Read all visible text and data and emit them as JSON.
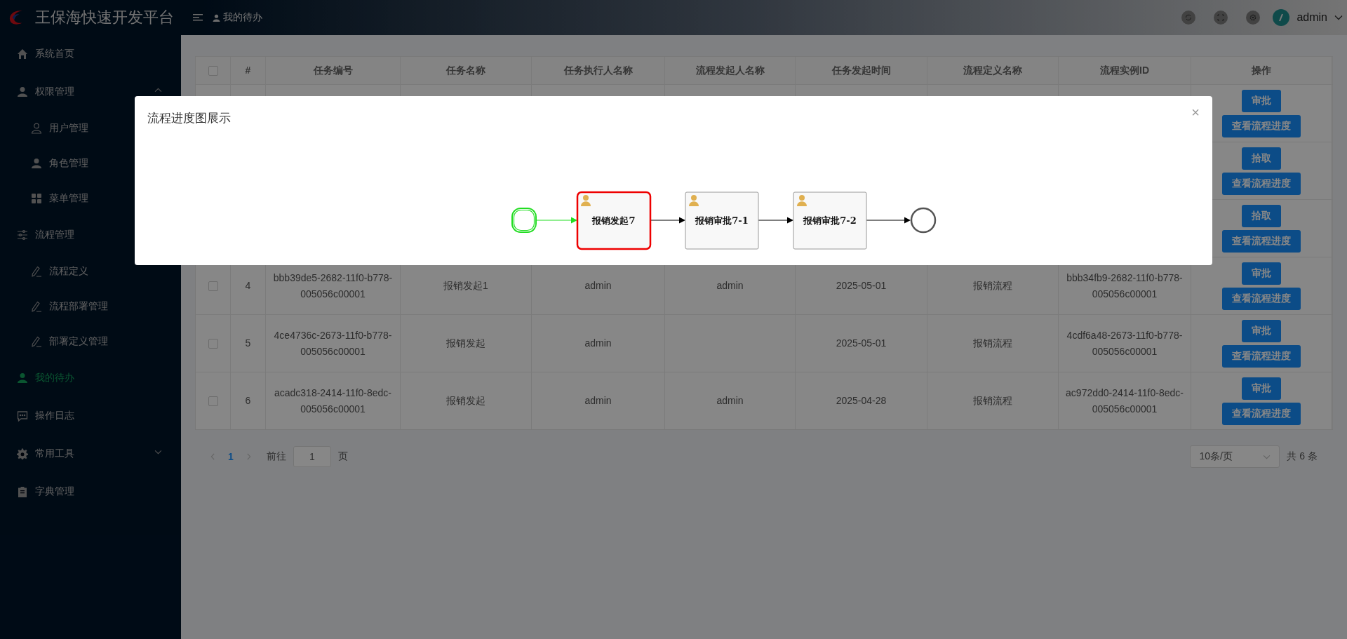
{
  "header": {
    "title": "王保海快速开发平台",
    "breadcrumb": "我的待办",
    "user": "admin"
  },
  "sidebar": {
    "items": [
      {
        "label": "系统首页",
        "selected": false
      },
      {
        "label": "权限管理",
        "selected": false,
        "expanded": true,
        "children": [
          {
            "label": "用户管理",
            "selected": false
          },
          {
            "label": "角色管理",
            "selected": false
          },
          {
            "label": "菜单管理",
            "selected": false
          }
        ]
      },
      {
        "label": "流程管理",
        "selected": false,
        "children": [
          {
            "label": "流程定义",
            "selected": false
          },
          {
            "label": "流程部署管理",
            "selected": false
          },
          {
            "label": "部署定义管理",
            "selected": false
          }
        ]
      },
      {
        "label": "我的待办",
        "selected": true
      },
      {
        "label": "操作日志",
        "selected": false
      },
      {
        "label": "常用工具",
        "selected": false,
        "expanded": false
      },
      {
        "label": "字典管理",
        "selected": false
      }
    ]
  },
  "table": {
    "columns": [
      "#",
      "任务编号",
      "任务名称",
      "任务执行人名称",
      "流程发起人名称",
      "任务发起时间",
      "流程定义名称",
      "流程实例ID",
      "操作"
    ],
    "header_checked": false,
    "rows": [
      {
        "actions": [
          "审批",
          "查看流程进度"
        ]
      },
      {
        "actions": [
          "拾取",
          "查看流程进度"
        ]
      },
      {
        "actions": [
          "拾取",
          "查看流程进度"
        ]
      },
      {
        "checked": false,
        "cells": [
          "4",
          "bbb39de5-2682-11f0-b778-005056c00001",
          "报销发起1",
          "admin",
          "admin",
          "2025-05-01",
          "报销流程",
          "bbb34fb9-2682-11f0-b778-005056c00001"
        ],
        "actions": [
          "审批",
          "查看流程进度"
        ]
      },
      {
        "checked": false,
        "cells": [
          "5",
          "4ce4736c-2673-11f0-b778-005056c00001",
          "报销发起",
          "admin",
          "",
          "2025-05-01",
          "报销流程",
          "4cdf6a48-2673-11f0-b778-005056c00001"
        ],
        "actions": [
          "审批",
          "查看流程进度"
        ]
      },
      {
        "checked": false,
        "cells": [
          "6",
          "acadc318-2414-11f0-8edc-005056c00001",
          "报销发起",
          "admin",
          "admin",
          "2025-04-28",
          "报销流程",
          "ac972dd0-2414-11f0-8edc-005056c00001"
        ],
        "actions": [
          "审批",
          "查看流程进度"
        ]
      }
    ]
  },
  "pagination": {
    "pages": [
      {
        "label": "1",
        "selected": true
      }
    ],
    "goto_label": "前往",
    "goto_value": "1",
    "goto_suffix": "页",
    "page_size": "10条/页",
    "total": "共 6 条"
  },
  "dialog": {
    "title": "流程进度图展示",
    "close": "×",
    "nodes": [
      {
        "kind": "start",
        "done": true,
        "current": false
      },
      {
        "kind": "task",
        "label": "报销发起7",
        "done": false,
        "current": true
      },
      {
        "kind": "task",
        "label": "报销审批7-1",
        "done": false,
        "current": false
      },
      {
        "kind": "task",
        "label": "报销审批7-2",
        "done": false,
        "current": false
      },
      {
        "kind": "end",
        "done": false,
        "current": false
      }
    ]
  }
}
